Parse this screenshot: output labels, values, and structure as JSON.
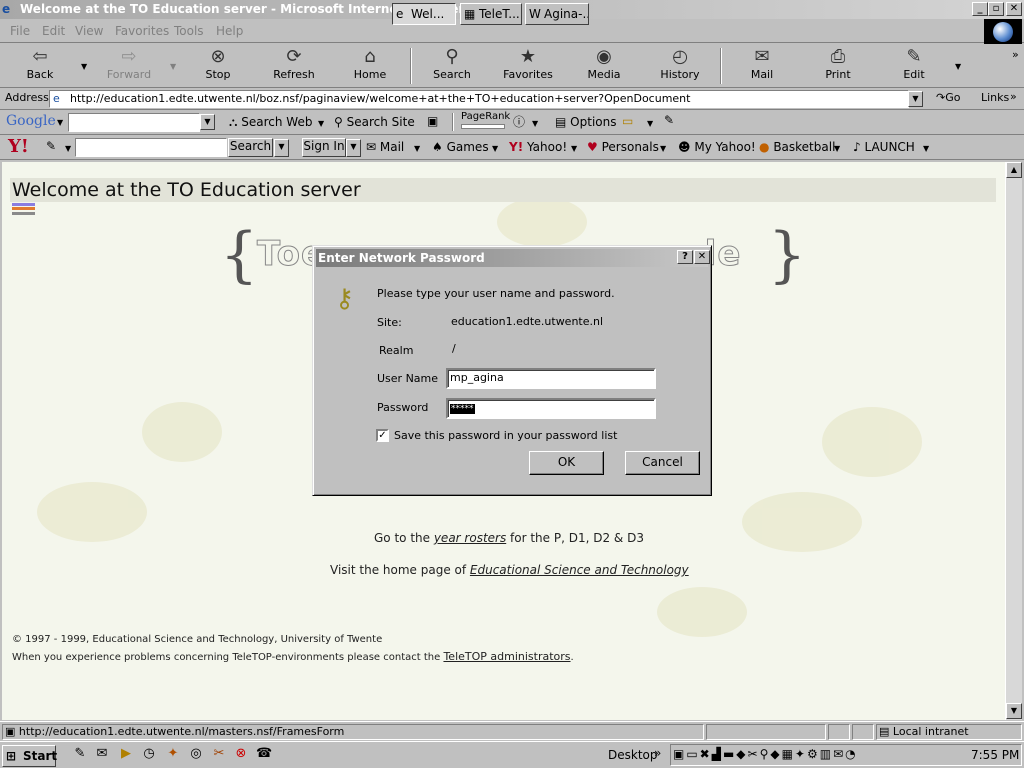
{
  "window": {
    "title": "Welcome at the TO Education server - Microsoft Internet Explorer"
  },
  "menu": [
    "File",
    "Edit",
    "View",
    "Favorites",
    "Tools",
    "Help"
  ],
  "toolbar": {
    "back": "Back",
    "forward": "Forward",
    "stop": "Stop",
    "refresh": "Refresh",
    "home": "Home",
    "search": "Search",
    "favorites": "Favorites",
    "media": "Media",
    "history": "History",
    "mail": "Mail",
    "print": "Print",
    "edit": "Edit"
  },
  "address": {
    "label": "Address",
    "url": "http://education1.edte.utwente.nl/boz.nsf/paginaview/welcome+at+the+TO+education+server?OpenDocument",
    "go": "Go",
    "links": "Links"
  },
  "google": {
    "logo": "Google",
    "search_web": "Search Web",
    "search_site": "Search Site",
    "pagerank": "PageRank",
    "options": "Options"
  },
  "yahoo": {
    "logo": "Y!",
    "search": "Search",
    "signin": "Sign In",
    "mail": "Mail",
    "games": "Games",
    "yahoo": "Yahoo!",
    "personals": "Personals",
    "myyahoo": "My Yahoo!",
    "basketball": "Basketball",
    "launch": "LAUNCH"
  },
  "page": {
    "title": "Welcome at the TO Education server",
    "banner": "Toe",
    "banner_tail": "de",
    "line1_pre": "Go to the ",
    "line1_link": "year rosters",
    "line1_post": " for the P, D1, D2 & D3",
    "line2_pre": "Visit the home page of ",
    "line2_link": "Educational Science and Technology",
    "footer1": "© 1997 - 1999, Educational Science and Technology, University of Twente",
    "footer2_pre": "When you experience problems concerning TeleTOP-environments please contact the ",
    "footer2_link": "TeleTOP administrators",
    "footer2_post": "."
  },
  "dialog": {
    "title": "Enter Network Password",
    "prompt": "Please type your user name and password.",
    "site_label": "Site:",
    "site_value": "education1.edte.utwente.nl",
    "realm_label": "Realm",
    "realm_value": "/",
    "user_label": "User Name",
    "user_value": "mp_agina",
    "password_label": "Password",
    "password_value": "*****",
    "save_label": "Save this password in your password list",
    "save_checked": true,
    "ok": "OK",
    "cancel": "Cancel"
  },
  "status": {
    "url": "http://education1.edte.utwente.nl/masters.nsf/FramesForm",
    "zone": "Local intranet"
  },
  "taskbar": {
    "start": "Start",
    "tasks": [
      "Wel...",
      "TeleT...",
      "Agina-..."
    ],
    "desktop": "Desktop",
    "clock": "7:55 PM"
  }
}
